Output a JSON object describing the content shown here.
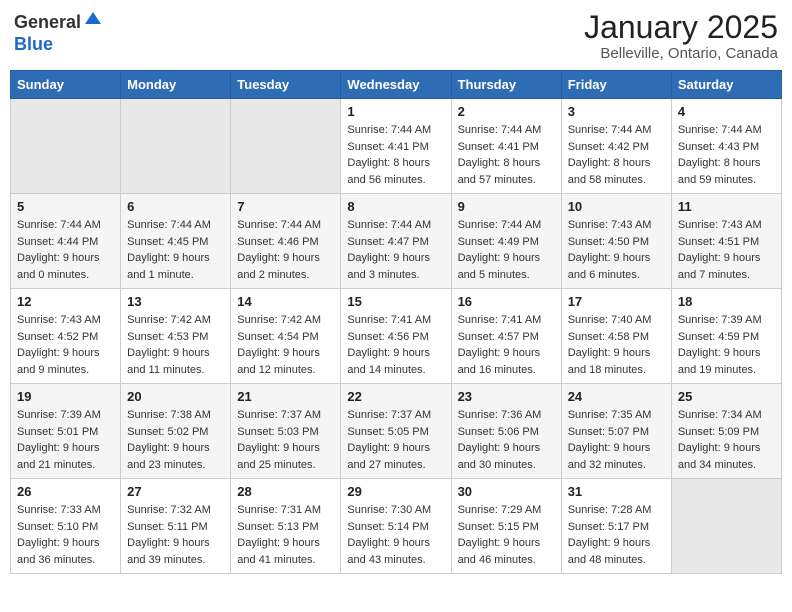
{
  "header": {
    "logo_general": "General",
    "logo_blue": "Blue",
    "month_title": "January 2025",
    "subtitle": "Belleville, Ontario, Canada"
  },
  "weekdays": [
    "Sunday",
    "Monday",
    "Tuesday",
    "Wednesday",
    "Thursday",
    "Friday",
    "Saturday"
  ],
  "weeks": [
    [
      {
        "day": "",
        "info": ""
      },
      {
        "day": "",
        "info": ""
      },
      {
        "day": "",
        "info": ""
      },
      {
        "day": "1",
        "info": "Sunrise: 7:44 AM\nSunset: 4:41 PM\nDaylight: 8 hours\nand 56 minutes."
      },
      {
        "day": "2",
        "info": "Sunrise: 7:44 AM\nSunset: 4:41 PM\nDaylight: 8 hours\nand 57 minutes."
      },
      {
        "day": "3",
        "info": "Sunrise: 7:44 AM\nSunset: 4:42 PM\nDaylight: 8 hours\nand 58 minutes."
      },
      {
        "day": "4",
        "info": "Sunrise: 7:44 AM\nSunset: 4:43 PM\nDaylight: 8 hours\nand 59 minutes."
      }
    ],
    [
      {
        "day": "5",
        "info": "Sunrise: 7:44 AM\nSunset: 4:44 PM\nDaylight: 9 hours\nand 0 minutes."
      },
      {
        "day": "6",
        "info": "Sunrise: 7:44 AM\nSunset: 4:45 PM\nDaylight: 9 hours\nand 1 minute."
      },
      {
        "day": "7",
        "info": "Sunrise: 7:44 AM\nSunset: 4:46 PM\nDaylight: 9 hours\nand 2 minutes."
      },
      {
        "day": "8",
        "info": "Sunrise: 7:44 AM\nSunset: 4:47 PM\nDaylight: 9 hours\nand 3 minutes."
      },
      {
        "day": "9",
        "info": "Sunrise: 7:44 AM\nSunset: 4:49 PM\nDaylight: 9 hours\nand 5 minutes."
      },
      {
        "day": "10",
        "info": "Sunrise: 7:43 AM\nSunset: 4:50 PM\nDaylight: 9 hours\nand 6 minutes."
      },
      {
        "day": "11",
        "info": "Sunrise: 7:43 AM\nSunset: 4:51 PM\nDaylight: 9 hours\nand 7 minutes."
      }
    ],
    [
      {
        "day": "12",
        "info": "Sunrise: 7:43 AM\nSunset: 4:52 PM\nDaylight: 9 hours\nand 9 minutes."
      },
      {
        "day": "13",
        "info": "Sunrise: 7:42 AM\nSunset: 4:53 PM\nDaylight: 9 hours\nand 11 minutes."
      },
      {
        "day": "14",
        "info": "Sunrise: 7:42 AM\nSunset: 4:54 PM\nDaylight: 9 hours\nand 12 minutes."
      },
      {
        "day": "15",
        "info": "Sunrise: 7:41 AM\nSunset: 4:56 PM\nDaylight: 9 hours\nand 14 minutes."
      },
      {
        "day": "16",
        "info": "Sunrise: 7:41 AM\nSunset: 4:57 PM\nDaylight: 9 hours\nand 16 minutes."
      },
      {
        "day": "17",
        "info": "Sunrise: 7:40 AM\nSunset: 4:58 PM\nDaylight: 9 hours\nand 18 minutes."
      },
      {
        "day": "18",
        "info": "Sunrise: 7:39 AM\nSunset: 4:59 PM\nDaylight: 9 hours\nand 19 minutes."
      }
    ],
    [
      {
        "day": "19",
        "info": "Sunrise: 7:39 AM\nSunset: 5:01 PM\nDaylight: 9 hours\nand 21 minutes."
      },
      {
        "day": "20",
        "info": "Sunrise: 7:38 AM\nSunset: 5:02 PM\nDaylight: 9 hours\nand 23 minutes."
      },
      {
        "day": "21",
        "info": "Sunrise: 7:37 AM\nSunset: 5:03 PM\nDaylight: 9 hours\nand 25 minutes."
      },
      {
        "day": "22",
        "info": "Sunrise: 7:37 AM\nSunset: 5:05 PM\nDaylight: 9 hours\nand 27 minutes."
      },
      {
        "day": "23",
        "info": "Sunrise: 7:36 AM\nSunset: 5:06 PM\nDaylight: 9 hours\nand 30 minutes."
      },
      {
        "day": "24",
        "info": "Sunrise: 7:35 AM\nSunset: 5:07 PM\nDaylight: 9 hours\nand 32 minutes."
      },
      {
        "day": "25",
        "info": "Sunrise: 7:34 AM\nSunset: 5:09 PM\nDaylight: 9 hours\nand 34 minutes."
      }
    ],
    [
      {
        "day": "26",
        "info": "Sunrise: 7:33 AM\nSunset: 5:10 PM\nDaylight: 9 hours\nand 36 minutes."
      },
      {
        "day": "27",
        "info": "Sunrise: 7:32 AM\nSunset: 5:11 PM\nDaylight: 9 hours\nand 39 minutes."
      },
      {
        "day": "28",
        "info": "Sunrise: 7:31 AM\nSunset: 5:13 PM\nDaylight: 9 hours\nand 41 minutes."
      },
      {
        "day": "29",
        "info": "Sunrise: 7:30 AM\nSunset: 5:14 PM\nDaylight: 9 hours\nand 43 minutes."
      },
      {
        "day": "30",
        "info": "Sunrise: 7:29 AM\nSunset: 5:15 PM\nDaylight: 9 hours\nand 46 minutes."
      },
      {
        "day": "31",
        "info": "Sunrise: 7:28 AM\nSunset: 5:17 PM\nDaylight: 9 hours\nand 48 minutes."
      },
      {
        "day": "",
        "info": ""
      }
    ]
  ]
}
